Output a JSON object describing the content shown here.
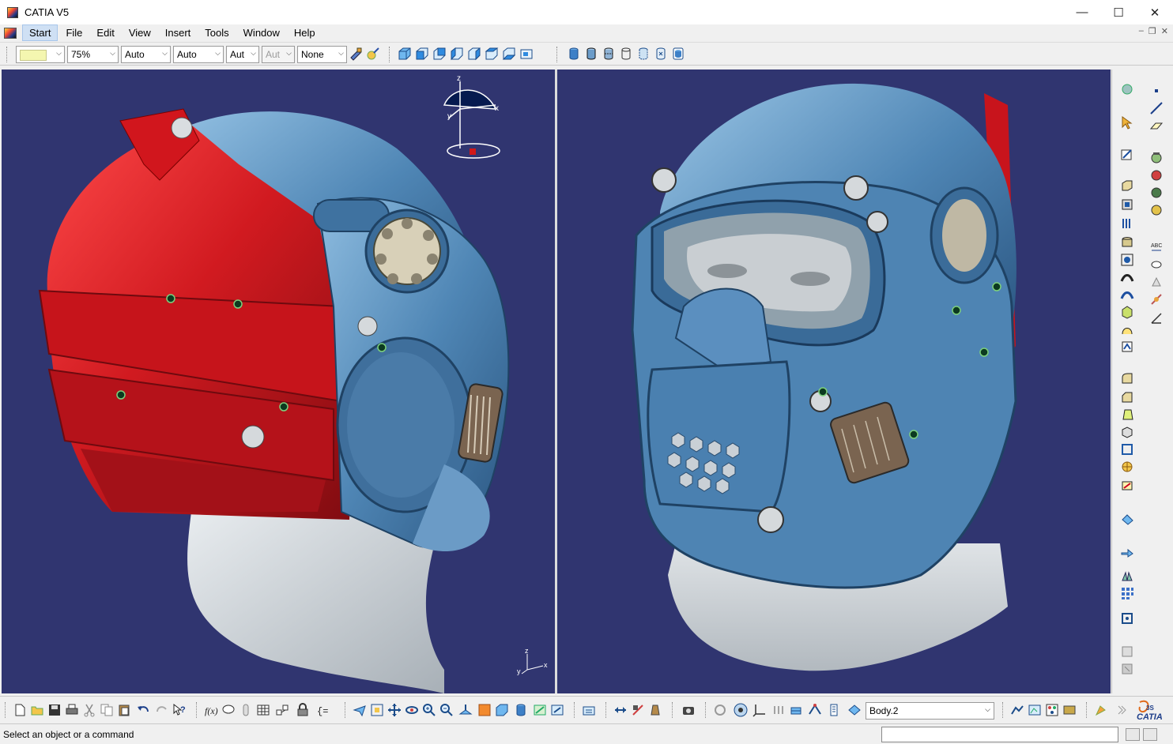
{
  "window": {
    "title": "CATIA V5"
  },
  "menu": {
    "items": [
      {
        "label": "Start"
      },
      {
        "label": "File"
      },
      {
        "label": "Edit"
      },
      {
        "label": "View"
      },
      {
        "label": "Insert"
      },
      {
        "label": "Tools"
      },
      {
        "label": "Window"
      },
      {
        "label": "Help"
      }
    ]
  },
  "toolbar": {
    "color_value": "",
    "transparency_value": "75%",
    "line_thickness_value": "Auto",
    "line_type_value": "Auto",
    "point_symbol_value": "Aut",
    "rendering_style_value": "Aut",
    "layer_value": "None"
  },
  "bottom_toolbar": {
    "body_selector_value": "Body.2"
  },
  "status": {
    "message": "Select an object or a command"
  },
  "compass_axes": {
    "x": "x",
    "y": "y",
    "z": "z"
  },
  "colors": {
    "viewport_background": "#303570",
    "helmet_red": "#c8141c",
    "helmet_blue": "#5a8dbb",
    "mannequin_grey": "#c9ced2",
    "ui_chrome": "#f0f0f0"
  }
}
